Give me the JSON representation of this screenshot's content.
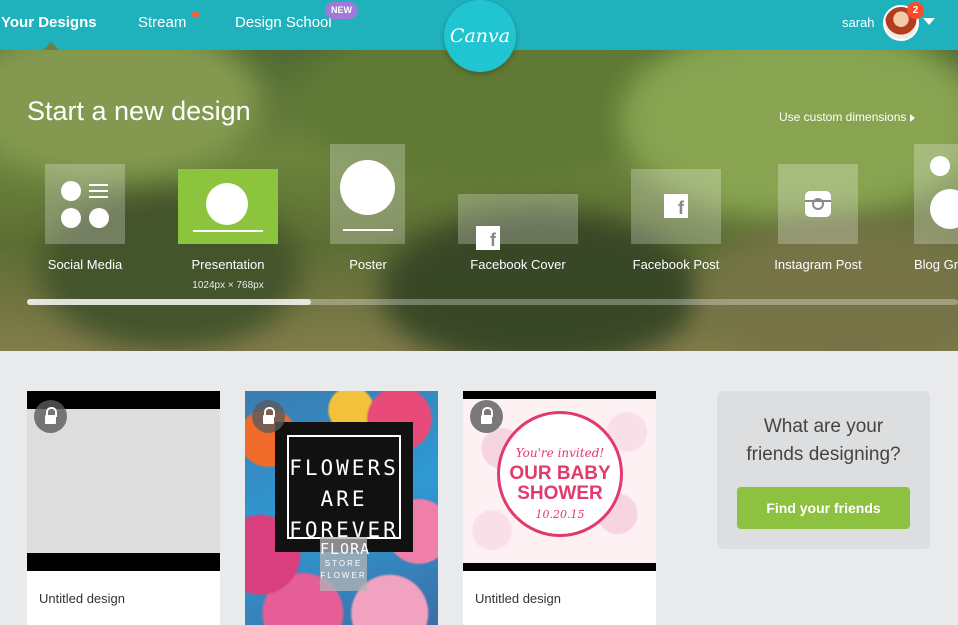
{
  "nav": {
    "your_designs": "Your Designs",
    "stream": "Stream",
    "design_school": "Design School",
    "new_badge": "NEW",
    "logo_text": "Canva",
    "username": "sarah",
    "notification_count": "2"
  },
  "hero": {
    "title": "Start a new design",
    "custom_dimensions": "Use custom dimensions",
    "types": [
      {
        "label": "Social Media",
        "icon": "social-media-icon"
      },
      {
        "label": "Presentation",
        "sub": "1024px × 768px",
        "icon": "presentation-icon",
        "selected": true
      },
      {
        "label": "Poster",
        "icon": "poster-icon"
      },
      {
        "label": "Facebook Cover",
        "icon": "facebook-icon"
      },
      {
        "label": "Facebook Post",
        "icon": "facebook-icon"
      },
      {
        "label": "Instagram Post",
        "icon": "instagram-icon"
      },
      {
        "label": "Blog Gr",
        "icon": "blog-graphic-icon"
      }
    ]
  },
  "designs": [
    {
      "name": "Untitled design"
    },
    {
      "title": "FLOWERS ARE FOREVER",
      "line1": "FLOWERS",
      "line2": "ARE",
      "line3": "FOREVER",
      "brand": "FLORA",
      "brand_sub1": "STORE",
      "brand_sub2": "FLOWER"
    },
    {
      "invite": "You're invited!",
      "title_line1": "OUR BABY",
      "title_line2": "SHOWER",
      "date": "10.20.15",
      "name": "Untitled design"
    }
  ],
  "friends": {
    "line1": "What are your",
    "line2": "friends designing?",
    "button": "Find your friends"
  },
  "colors": {
    "brand_teal": "#1fb2bd",
    "accent_green": "#8dc43e",
    "notification_red": "#ff4a2a",
    "badge_purple": "#a07ad8",
    "shower_pink": "#e23a6d"
  }
}
